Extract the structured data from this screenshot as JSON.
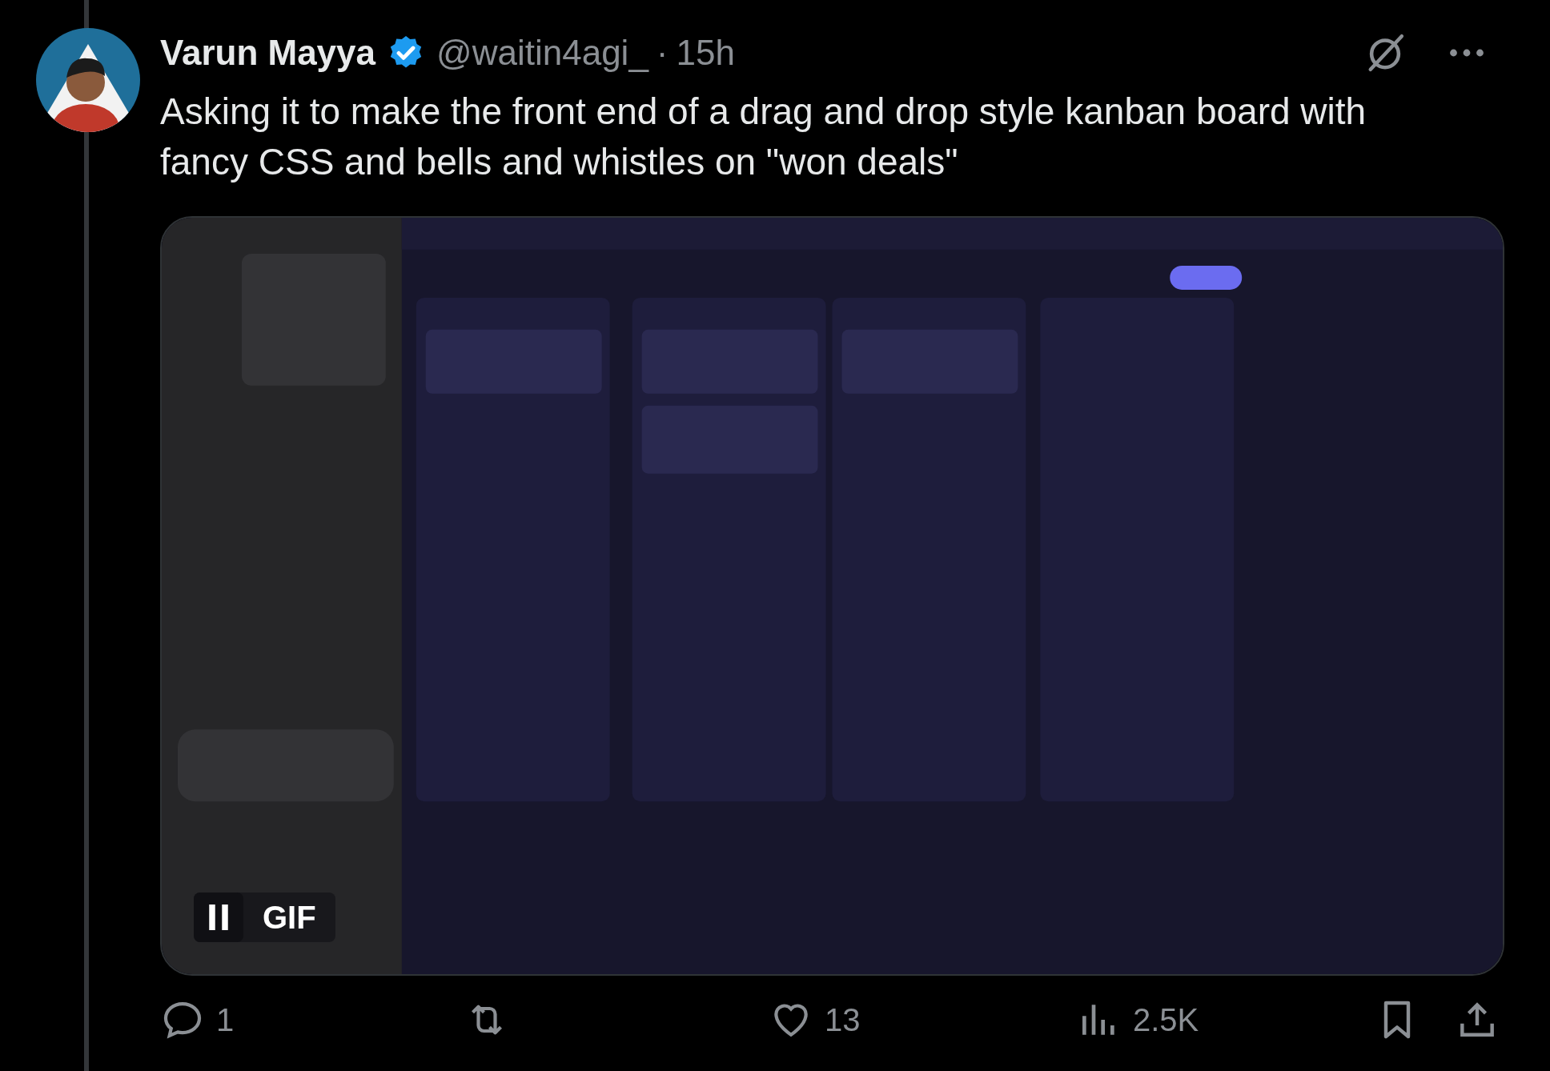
{
  "author": {
    "name": "Varun Mayya",
    "verified": true,
    "handle": "@waitin4agi_",
    "separator": "·",
    "time": "15h"
  },
  "text": "Asking it to make the front end of a drag and drop style kanban board with fancy CSS and bells and whistles on \"won deals\"",
  "media": {
    "kind": "picture",
    "badge": "GIF",
    "paused": false
  },
  "actions": [
    {
      "kind": "reply",
      "count": "1"
    },
    {
      "kind": "repost"
    },
    {
      "kind": "like",
      "count": "13"
    },
    {
      "kind": "views",
      "count": "2.5K"
    },
    {
      "kind": "bookmark"
    },
    {
      "kind": "share"
    }
  ]
}
